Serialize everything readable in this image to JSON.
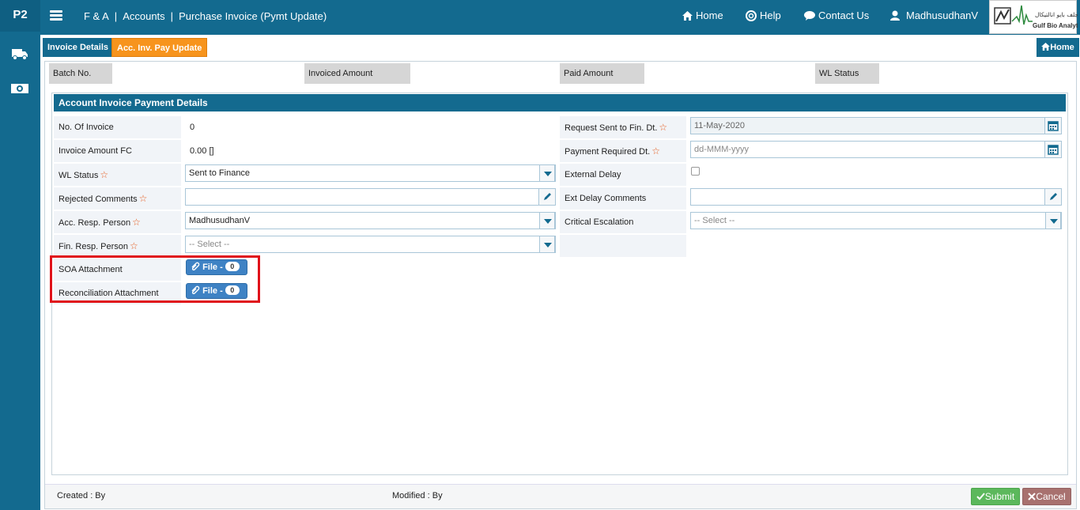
{
  "sidebar": {
    "brand": "P2",
    "icons": [
      "truck-icon",
      "money-icon"
    ]
  },
  "topbar": {
    "breadcrumb": [
      "F & A",
      "Accounts",
      "Purchase Invoice (Pymt Update)"
    ],
    "nav": {
      "home": "Home",
      "help": "Help",
      "contact": "Contact Us",
      "user": "MadhusudhanV"
    },
    "logo": {
      "arabic": "جلف بايو انالتيكال",
      "english": "Gulf Bio Analytical"
    }
  },
  "tabs": [
    {
      "label": "Invoice Details"
    },
    {
      "label": "Acc. Inv. Pay Update"
    }
  ],
  "home_button": "Home",
  "summary": {
    "batch_no": "Batch No.",
    "invoiced_amount": "Invoiced Amount",
    "paid_amount": "Paid Amount",
    "wl_status": "WL Status"
  },
  "panel": {
    "title": "Account Invoice Payment Details",
    "left": {
      "no_of_invoice": {
        "label": "No. Of Invoice",
        "value": "0"
      },
      "invoice_amount_fc": {
        "label": "Invoice Amount FC",
        "value": "0.00 []"
      },
      "wl_status": {
        "label": "WL Status",
        "value": "Sent to Finance"
      },
      "rejected_comments": {
        "label": "Rejected Comments",
        "value": ""
      },
      "acc_resp_person": {
        "label": "Acc. Resp. Person",
        "value": "MadhusudhanV"
      },
      "fin_resp_person": {
        "label": "Fin. Resp. Person",
        "value": "-- Select --"
      },
      "soa_attachment": {
        "label": "SOA Attachment",
        "button": "File -",
        "count": "0"
      },
      "reconciliation_attachment": {
        "label": "Reconciliation Attachment",
        "button": "File -",
        "count": "0"
      }
    },
    "right": {
      "request_sent": {
        "label": "Request Sent to Fin. Dt.",
        "value": "11-May-2020"
      },
      "payment_required": {
        "label": "Payment Required Dt.",
        "placeholder": "dd-MMM-yyyy"
      },
      "external_delay": {
        "label": "External Delay"
      },
      "ext_delay_comments": {
        "label": "Ext Delay Comments",
        "value": ""
      },
      "critical_escalation": {
        "label": "Critical Escalation",
        "value": "-- Select --"
      }
    }
  },
  "footer": {
    "created": "Created : By",
    "modified": "Modified : By",
    "submit": "Submit",
    "cancel": "Cancel"
  },
  "colors": {
    "primary": "#136a8f",
    "accent": "#f7941d",
    "success": "#5cb85c",
    "danger": "#a8716f",
    "highlight": "#e0121a"
  }
}
